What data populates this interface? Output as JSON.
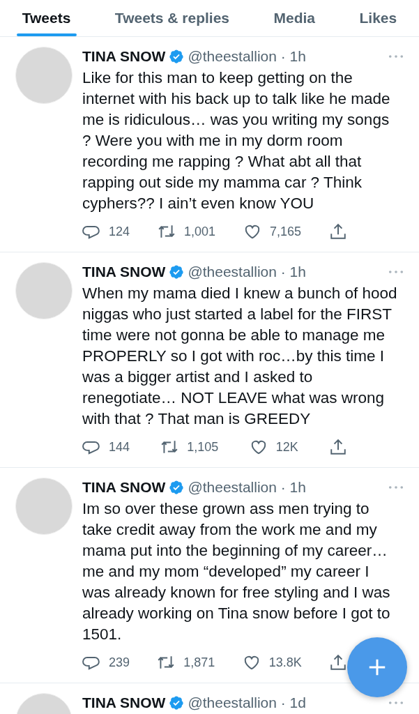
{
  "tabs": [
    {
      "label": "Tweets",
      "selected": true
    },
    {
      "label": "Tweets & replies",
      "selected": false
    },
    {
      "label": "Media",
      "selected": false
    },
    {
      "label": "Likes",
      "selected": false
    }
  ],
  "tweets": [
    {
      "name": "TINA SNOW",
      "handle": "@theestallion · 1h",
      "text": "Like for this man to keep getting on the internet with his back up to talk like he made me is ridiculous… was you writing my songs ? Were you with me in my dorm room recording me rapping ? What abt all that rapping out side my mamma car ? Think cyphers?? I ain’t even know YOU",
      "replies": "124",
      "retweets": "1,001",
      "likes": "7,165"
    },
    {
      "name": "TINA SNOW",
      "handle": "@theestallion · 1h",
      "text": "When my mama died I knew a bunch of hood niggas who just started a label for the FIRST time were not gonna be able to manage me PROPERLY so I got with roc…by this time I was a bigger artist and I asked to renegotiate… NOT LEAVE what was wrong with that ? That man is GREEDY",
      "replies": "144",
      "retweets": "1,105",
      "likes": "12K"
    },
    {
      "name": "TINA SNOW",
      "handle": "@theestallion · 1h",
      "text": "Im so over these grown ass men trying to take credit away from the work me and my mama put into the beginning of my career… me and my mom “developed” my career I was already known for free styling and I was already working on Tina snow before I got to 1501.",
      "replies": "239",
      "retweets": "1,871",
      "likes": "13.8K"
    }
  ],
  "partial_tweet": {
    "name": "TINA SNOW",
    "handle": "@theestallion · 1d"
  }
}
